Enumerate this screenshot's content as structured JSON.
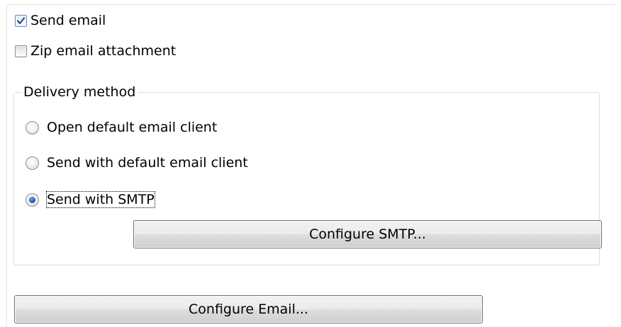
{
  "options": {
    "send_email": {
      "label": "Send email",
      "checked": true
    },
    "zip_attachment": {
      "label": "Zip email attachment",
      "checked": false
    }
  },
  "delivery": {
    "group_label": "Delivery method",
    "methods": [
      {
        "label": "Open default email client",
        "selected": false
      },
      {
        "label": "Send with default email client",
        "selected": false
      },
      {
        "label": "Send with SMTP",
        "selected": true
      }
    ],
    "configure_smtp_label": "Configure SMTP..."
  },
  "configure_email_label": "Configure Email..."
}
